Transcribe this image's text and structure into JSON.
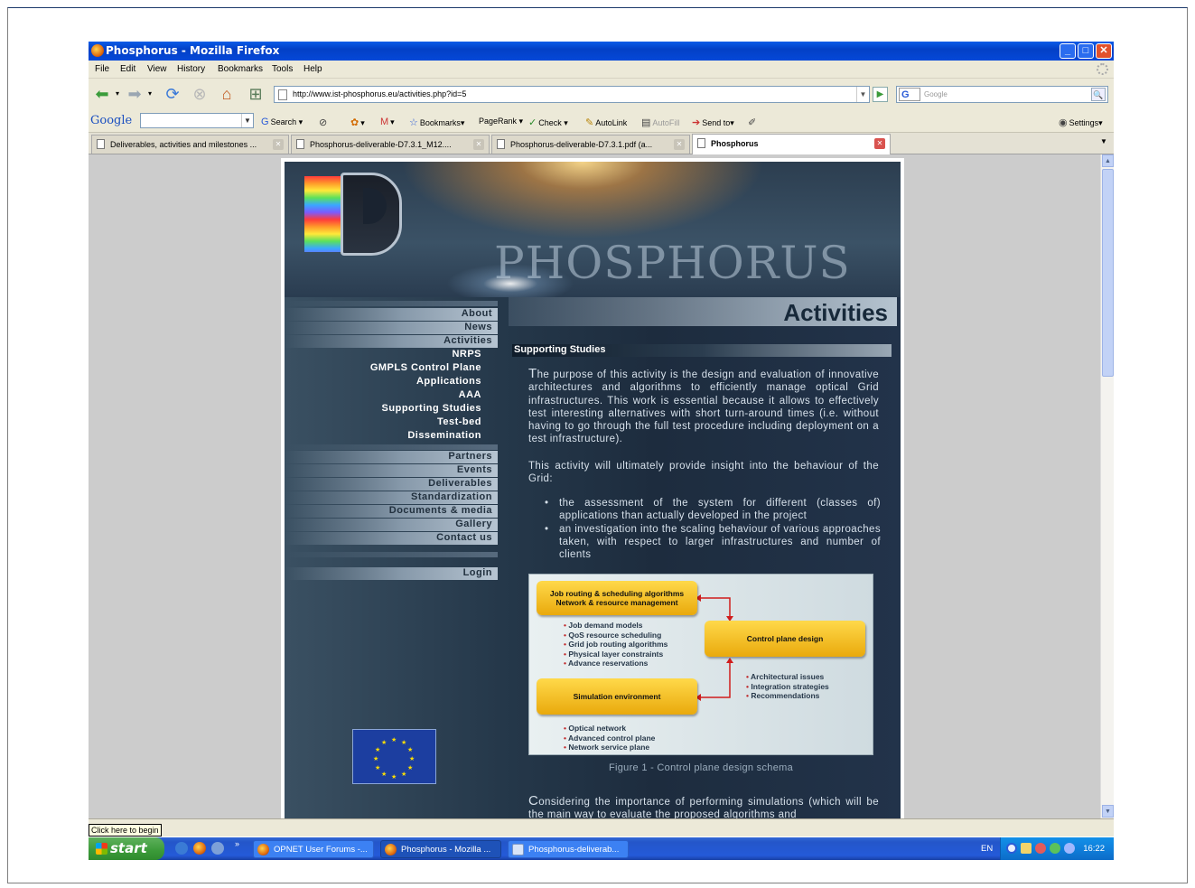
{
  "window": {
    "title": "Phosphorus - Mozilla Firefox",
    "controls": {
      "minimize": "_",
      "maximize": "□",
      "close": "✕"
    }
  },
  "menubar": {
    "items": [
      {
        "label": "File"
      },
      {
        "label": "Edit"
      },
      {
        "label": "View"
      },
      {
        "label": "History"
      },
      {
        "label": "Bookmarks"
      },
      {
        "label": "Tools"
      },
      {
        "label": "Help"
      }
    ]
  },
  "navbar": {
    "url": "http://www.ist-phosphorus.eu/activities.php?id=5",
    "search_placeholder": "Google",
    "search_engine_icon": "G",
    "icons": [
      "back-icon",
      "forward-icon",
      "reload-icon",
      "stop-icon",
      "home-icon",
      "new-tab-icon"
    ]
  },
  "googlebar": {
    "logo": "Google",
    "items": [
      {
        "label": "Search"
      },
      {
        "label": "Bookmarks"
      },
      {
        "label": "PageRank"
      },
      {
        "label": "Check"
      },
      {
        "label": "AutoLink"
      },
      {
        "label": "AutoFill"
      },
      {
        "label": "Send to"
      },
      {
        "label": "Settings"
      }
    ]
  },
  "tabs": [
    {
      "label": "Deliverables, activities and milestones ...",
      "active": false
    },
    {
      "label": "Phosphorus-deliverable-D7.3.1_M12....",
      "active": false
    },
    {
      "label": "Phosphorus-deliverable-D7.3.1.pdf (a...",
      "active": false
    },
    {
      "label": "Phosphorus",
      "active": true
    }
  ],
  "site": {
    "wordmark": "PHOSPHORUS",
    "nav_primary": [
      {
        "label": "About"
      },
      {
        "label": "News"
      },
      {
        "label": "Activities"
      },
      {
        "label": "NRPS"
      },
      {
        "label": "GMPLS Control Plane"
      },
      {
        "label": "Applications"
      },
      {
        "label": "AAA"
      },
      {
        "label": "Supporting Studies"
      },
      {
        "label": "Test-bed"
      },
      {
        "label": "Dissemination"
      }
    ],
    "nav_secondary": [
      {
        "label": "Partners"
      },
      {
        "label": "Events"
      },
      {
        "label": "Deliverables"
      },
      {
        "label": "Standardization"
      },
      {
        "label": "Documents & media"
      },
      {
        "label": "Gallery"
      },
      {
        "label": "Contact us"
      }
    ],
    "login": "Login",
    "page_title": "Activities",
    "section_title": "Supporting Studies",
    "para1_initial": "T",
    "para1": "he purpose of this activity is the design and evaluation of innovative architectures and algorithms to efficiently manage optical Grid infrastructures. This work is essential because it allows to effectively test interesting alternatives with short turn-around times (i.e. without having to go through the full test procedure including deployment on a test infrastructure).",
    "para2": "This activity will ultimately provide insight into the behaviour of the Grid:",
    "bullets": [
      {
        "text": "the assessment of the system for different (classes of) applications than actually developed in the project"
      },
      {
        "text": "an investigation into the scaling behaviour of various approaches taken, with respect to larger infrastructures and number of clients"
      }
    ],
    "figure": {
      "box1_line1": "Job routing & scheduling algorithms",
      "box1_line2": "Network & resource management",
      "box2": "Control plane design",
      "box3": "Simulation environment",
      "list1": [
        "Job demand models",
        "QoS resource scheduling",
        "Grid job routing algorithms",
        "Physical layer constraints",
        "Advance reservations"
      ],
      "list2": [
        "Architectural issues",
        "Integration strategies",
        "Recommendations"
      ],
      "list3": [
        "Optical network",
        "Advanced control plane",
        "Network service plane"
      ]
    },
    "caption": "Figure 1 - Control plane design schema",
    "para3_initial": "C",
    "para3": "onsidering the importance of performing simulations (which will be the main way to evaluate the proposed algorithms and"
  },
  "statusbar": {
    "tooltip": "Click here to begin"
  },
  "taskbar": {
    "start": "start",
    "tasks": [
      {
        "label": "OPNET User Forums -..."
      },
      {
        "label": "Phosphorus - Mozilla ..."
      },
      {
        "label": "Phosphorus-deliverab..."
      }
    ],
    "lang": "EN",
    "clock": "16:22"
  }
}
